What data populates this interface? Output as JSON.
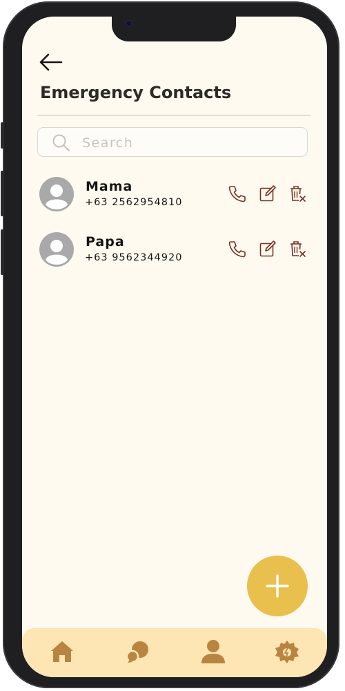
{
  "header": {
    "back_icon": "arrow-left-icon",
    "title": "Emergency Contacts"
  },
  "search": {
    "placeholder": "Search",
    "value": "",
    "icon": "search-icon"
  },
  "contacts": [
    {
      "name": "Mama",
      "phone": "+63 2562954810"
    },
    {
      "name": "Papa",
      "phone": "+63 9562344920"
    }
  ],
  "contact_actions": [
    "phone-icon",
    "edit-icon",
    "delete-icon"
  ],
  "fab": {
    "icon": "plus-icon"
  },
  "bottom_nav": {
    "items": [
      "home-icon",
      "chat-icon",
      "profile-icon",
      "settings-icon"
    ]
  },
  "colors": {
    "background": "#fffaef",
    "accent": "#e9bf4d",
    "nav_background": "#fde6b4",
    "nav_icon": "#b8843f",
    "action_icon": "#7a2f22",
    "avatar": "#a9a9a9"
  }
}
